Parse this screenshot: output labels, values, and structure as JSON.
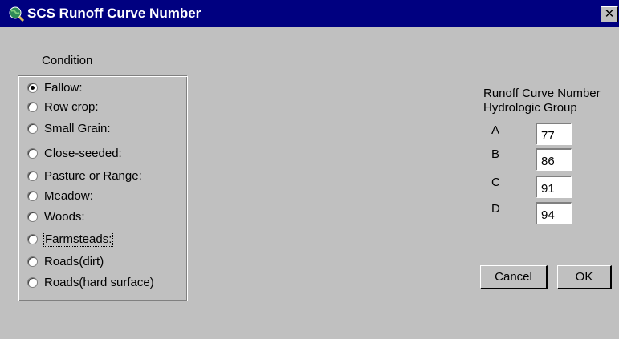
{
  "window": {
    "title": "SCS Runoff Curve Number",
    "close_glyph": "✕"
  },
  "condition": {
    "label": "Condition",
    "selected": "Fallow:",
    "focused": "Farmsteads:",
    "options": [
      "Fallow:",
      "Row crop:",
      "Small Grain:",
      "Close-seeded:",
      "Pasture or Range:",
      "Meadow:",
      "Woods:",
      "Farmsteads:",
      "Roads(dirt)",
      "Roads(hard surface)"
    ]
  },
  "curve_number": {
    "title": "Runoff Curve Number",
    "subtitle": "Hydrologic  Group",
    "groups": [
      {
        "letter": "A",
        "value": "77"
      },
      {
        "letter": "B",
        "value": "86"
      },
      {
        "letter": "C",
        "value": "91"
      },
      {
        "letter": "D",
        "value": "94"
      }
    ]
  },
  "buttons": {
    "cancel": "Cancel",
    "ok": "OK"
  },
  "icons": {
    "app": "globe-magnifier-icon",
    "close": "close-icon"
  }
}
